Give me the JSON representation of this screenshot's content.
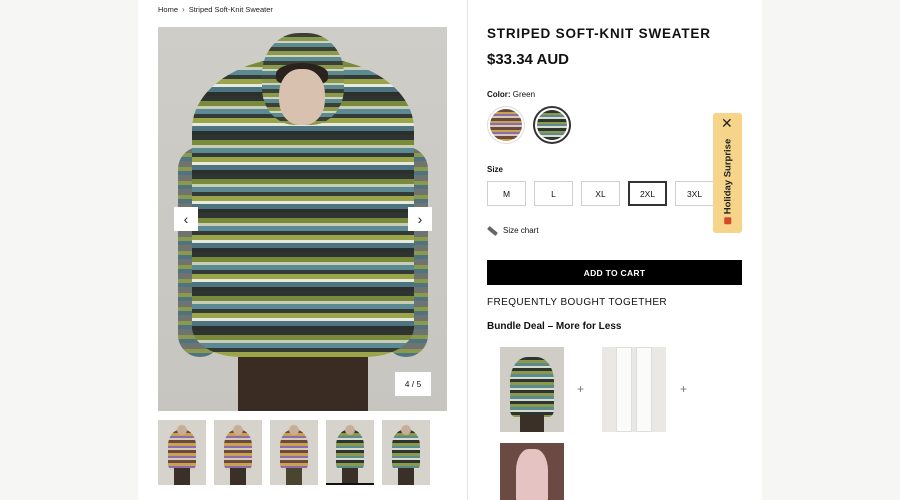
{
  "breadcrumb": {
    "home": "Home",
    "current": "Striped Soft-Knit Sweater"
  },
  "gallery": {
    "counter": "4 / 5",
    "prev_icon": "chevron-left-icon",
    "next_icon": "chevron-right-icon",
    "thumb_count": 5,
    "active_thumb": 4
  },
  "product": {
    "title": "STRIPED SOFT-KNIT SWEATER",
    "price": "$33.34 AUD"
  },
  "color": {
    "label": "Color:",
    "selected": "Green"
  },
  "size": {
    "label": "Size",
    "options": [
      "M",
      "L",
      "XL",
      "2XL",
      "3XL"
    ],
    "selected": "2XL"
  },
  "size_chart": {
    "label": "Size chart"
  },
  "cart": {
    "label": "ADD TO CART"
  },
  "frequently_bought": {
    "title": "FREQUENTLY BOUGHT TOGETHER"
  },
  "bundle": {
    "title": "Bundle Deal – More for Less",
    "plus": "+"
  },
  "holiday": {
    "label": "Holiday Surprise",
    "close_icon": "close-icon"
  },
  "colors": {
    "cta": "#000000",
    "holiday_bg": "#f6d58a"
  }
}
